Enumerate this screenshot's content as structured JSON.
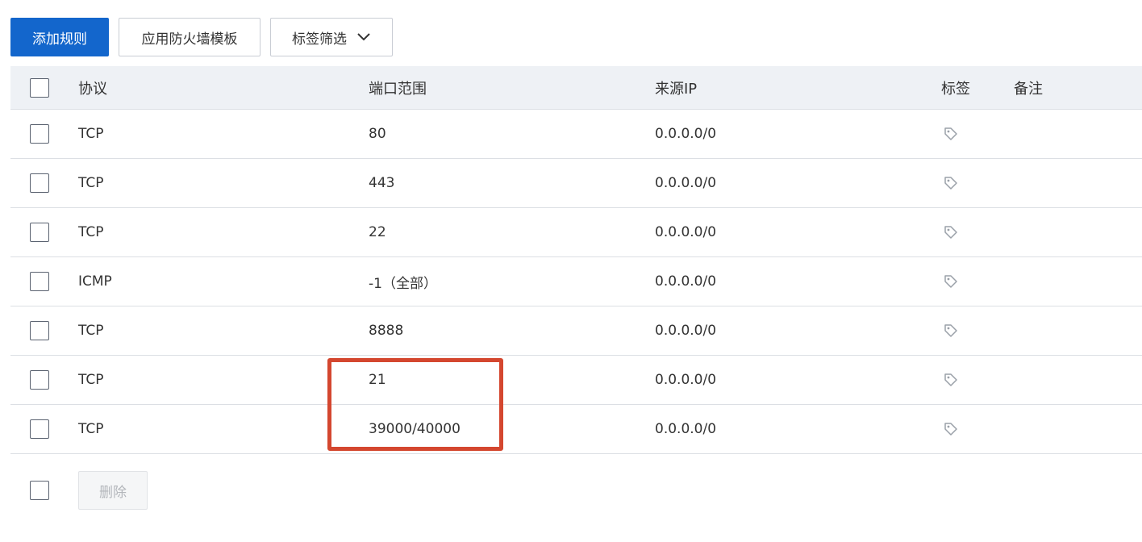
{
  "toolbar": {
    "add_rule": "添加规则",
    "apply_template": "应用防火墙模板",
    "tag_filter": "标签筛选"
  },
  "table": {
    "headers": {
      "protocol": "协议",
      "port_range": "端口范围",
      "source_ip": "来源IP",
      "tag": "标签",
      "note": "备注"
    },
    "rows": [
      {
        "protocol": "TCP",
        "port": "80",
        "source": "0.0.0.0/0"
      },
      {
        "protocol": "TCP",
        "port": "443",
        "source": "0.0.0.0/0"
      },
      {
        "protocol": "TCP",
        "port": "22",
        "source": "0.0.0.0/0"
      },
      {
        "protocol": "ICMP",
        "port": "-1（全部）",
        "source": "0.0.0.0/0"
      },
      {
        "protocol": "TCP",
        "port": "8888",
        "source": "0.0.0.0/0"
      },
      {
        "protocol": "TCP",
        "port": "21",
        "source": "0.0.0.0/0"
      },
      {
        "protocol": "TCP",
        "port": "39000/40000",
        "source": "0.0.0.0/0"
      }
    ]
  },
  "footer": {
    "delete": "删除"
  },
  "icons": {
    "tag": "tag-icon",
    "chevron": "chevron-down-icon"
  },
  "colors": {
    "primary": "#1366cc",
    "highlight": "#d4472f",
    "header_bg": "#eef1f5"
  }
}
